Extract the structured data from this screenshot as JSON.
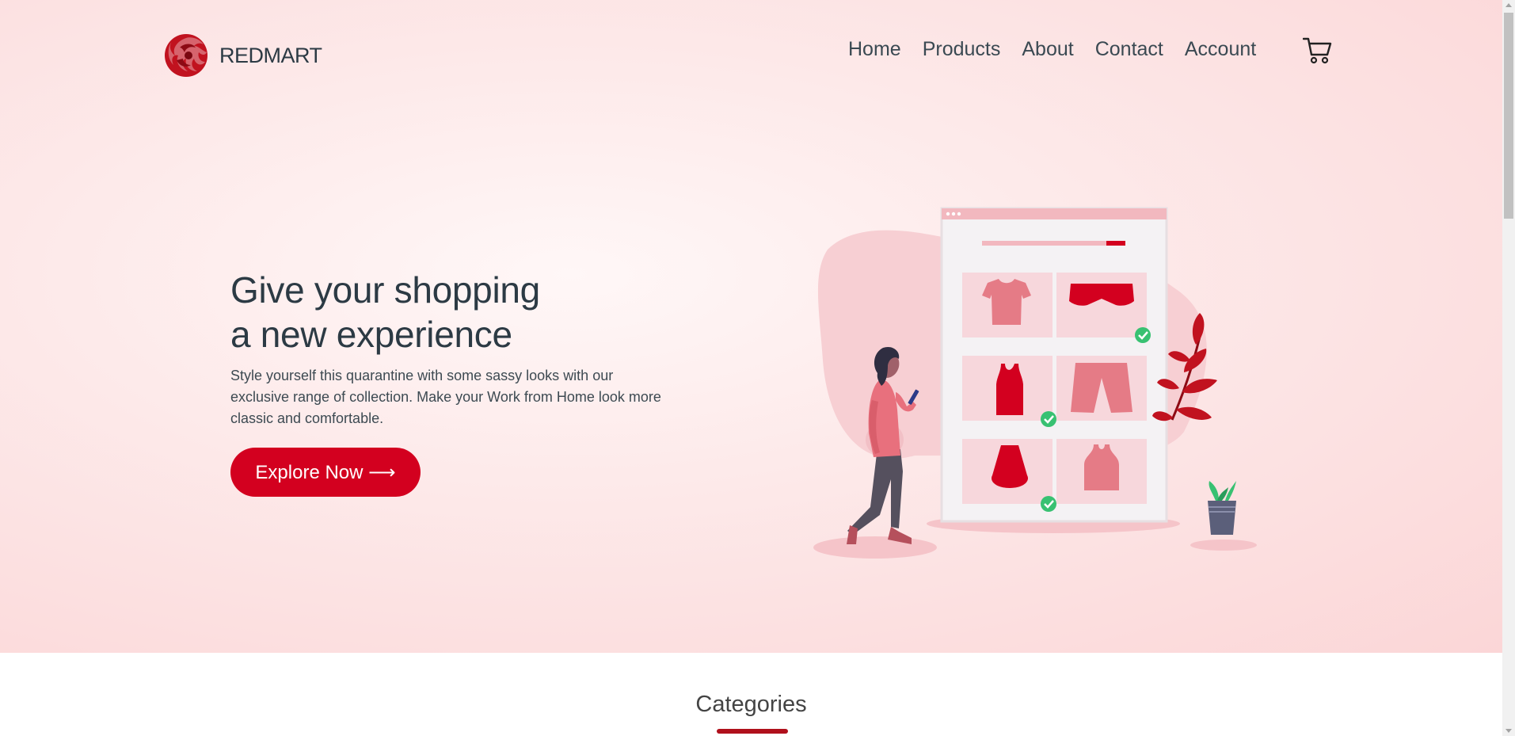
{
  "brand": {
    "name": "REDMART",
    "logo_icon": "flame-swirl-logo-icon",
    "accent": "#d3001f"
  },
  "nav": {
    "links": [
      "Home",
      "Products",
      "About",
      "Contact",
      "Account"
    ],
    "cart_icon": "shopping-cart-icon"
  },
  "hero": {
    "headline_line1": "Give your shopping",
    "headline_line2": "a new experience",
    "description": "Style yourself this quarantine with some sassy looks with our exclusive range of collection. Make your Work from Home look more classic and comfortable.",
    "cta_label": "Explore Now ⟶",
    "illustration": "woman-shopping-online-clothes-illustration"
  },
  "categories": {
    "title": "Categories"
  },
  "colors": {
    "primary": "#d3001f",
    "hero_bg": "#fbd6d7",
    "text_dark": "#2c3a44"
  }
}
